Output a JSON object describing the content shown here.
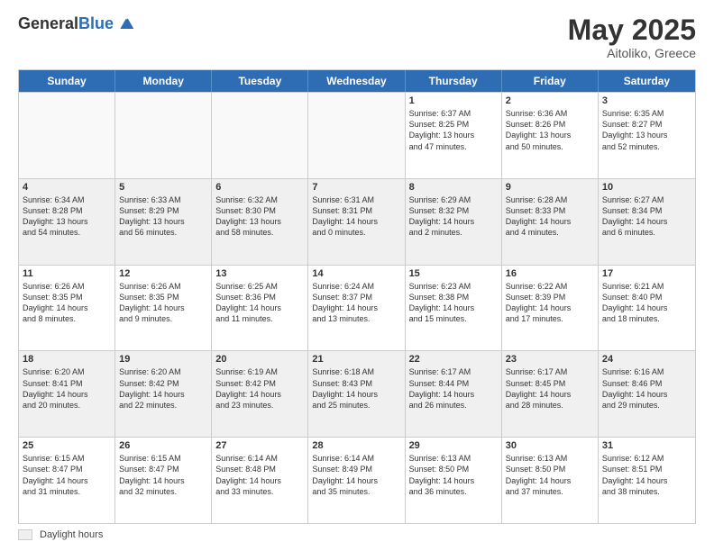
{
  "logo": {
    "general": "General",
    "blue": "Blue"
  },
  "title": "May 2025",
  "location": "Aitoliko, Greece",
  "days_of_week": [
    "Sunday",
    "Monday",
    "Tuesday",
    "Wednesday",
    "Thursday",
    "Friday",
    "Saturday"
  ],
  "legend": {
    "box_label": "Daylight hours"
  },
  "weeks": [
    [
      {
        "day": "",
        "info": "",
        "empty": true
      },
      {
        "day": "",
        "info": "",
        "empty": true
      },
      {
        "day": "",
        "info": "",
        "empty": true
      },
      {
        "day": "",
        "info": "",
        "empty": true
      },
      {
        "day": "1",
        "info": "Sunrise: 6:37 AM\nSunset: 8:25 PM\nDaylight: 13 hours\nand 47 minutes.",
        "empty": false
      },
      {
        "day": "2",
        "info": "Sunrise: 6:36 AM\nSunset: 8:26 PM\nDaylight: 13 hours\nand 50 minutes.",
        "empty": false
      },
      {
        "day": "3",
        "info": "Sunrise: 6:35 AM\nSunset: 8:27 PM\nDaylight: 13 hours\nand 52 minutes.",
        "empty": false
      }
    ],
    [
      {
        "day": "4",
        "info": "Sunrise: 6:34 AM\nSunset: 8:28 PM\nDaylight: 13 hours\nand 54 minutes.",
        "empty": false
      },
      {
        "day": "5",
        "info": "Sunrise: 6:33 AM\nSunset: 8:29 PM\nDaylight: 13 hours\nand 56 minutes.",
        "empty": false
      },
      {
        "day": "6",
        "info": "Sunrise: 6:32 AM\nSunset: 8:30 PM\nDaylight: 13 hours\nand 58 minutes.",
        "empty": false
      },
      {
        "day": "7",
        "info": "Sunrise: 6:31 AM\nSunset: 8:31 PM\nDaylight: 14 hours\nand 0 minutes.",
        "empty": false
      },
      {
        "day": "8",
        "info": "Sunrise: 6:29 AM\nSunset: 8:32 PM\nDaylight: 14 hours\nand 2 minutes.",
        "empty": false
      },
      {
        "day": "9",
        "info": "Sunrise: 6:28 AM\nSunset: 8:33 PM\nDaylight: 14 hours\nand 4 minutes.",
        "empty": false
      },
      {
        "day": "10",
        "info": "Sunrise: 6:27 AM\nSunset: 8:34 PM\nDaylight: 14 hours\nand 6 minutes.",
        "empty": false
      }
    ],
    [
      {
        "day": "11",
        "info": "Sunrise: 6:26 AM\nSunset: 8:35 PM\nDaylight: 14 hours\nand 8 minutes.",
        "empty": false
      },
      {
        "day": "12",
        "info": "Sunrise: 6:26 AM\nSunset: 8:35 PM\nDaylight: 14 hours\nand 9 minutes.",
        "empty": false
      },
      {
        "day": "13",
        "info": "Sunrise: 6:25 AM\nSunset: 8:36 PM\nDaylight: 14 hours\nand 11 minutes.",
        "empty": false
      },
      {
        "day": "14",
        "info": "Sunrise: 6:24 AM\nSunset: 8:37 PM\nDaylight: 14 hours\nand 13 minutes.",
        "empty": false
      },
      {
        "day": "15",
        "info": "Sunrise: 6:23 AM\nSunset: 8:38 PM\nDaylight: 14 hours\nand 15 minutes.",
        "empty": false
      },
      {
        "day": "16",
        "info": "Sunrise: 6:22 AM\nSunset: 8:39 PM\nDaylight: 14 hours\nand 17 minutes.",
        "empty": false
      },
      {
        "day": "17",
        "info": "Sunrise: 6:21 AM\nSunset: 8:40 PM\nDaylight: 14 hours\nand 18 minutes.",
        "empty": false
      }
    ],
    [
      {
        "day": "18",
        "info": "Sunrise: 6:20 AM\nSunset: 8:41 PM\nDaylight: 14 hours\nand 20 minutes.",
        "empty": false
      },
      {
        "day": "19",
        "info": "Sunrise: 6:20 AM\nSunset: 8:42 PM\nDaylight: 14 hours\nand 22 minutes.",
        "empty": false
      },
      {
        "day": "20",
        "info": "Sunrise: 6:19 AM\nSunset: 8:42 PM\nDaylight: 14 hours\nand 23 minutes.",
        "empty": false
      },
      {
        "day": "21",
        "info": "Sunrise: 6:18 AM\nSunset: 8:43 PM\nDaylight: 14 hours\nand 25 minutes.",
        "empty": false
      },
      {
        "day": "22",
        "info": "Sunrise: 6:17 AM\nSunset: 8:44 PM\nDaylight: 14 hours\nand 26 minutes.",
        "empty": false
      },
      {
        "day": "23",
        "info": "Sunrise: 6:17 AM\nSunset: 8:45 PM\nDaylight: 14 hours\nand 28 minutes.",
        "empty": false
      },
      {
        "day": "24",
        "info": "Sunrise: 6:16 AM\nSunset: 8:46 PM\nDaylight: 14 hours\nand 29 minutes.",
        "empty": false
      }
    ],
    [
      {
        "day": "25",
        "info": "Sunrise: 6:15 AM\nSunset: 8:47 PM\nDaylight: 14 hours\nand 31 minutes.",
        "empty": false
      },
      {
        "day": "26",
        "info": "Sunrise: 6:15 AM\nSunset: 8:47 PM\nDaylight: 14 hours\nand 32 minutes.",
        "empty": false
      },
      {
        "day": "27",
        "info": "Sunrise: 6:14 AM\nSunset: 8:48 PM\nDaylight: 14 hours\nand 33 minutes.",
        "empty": false
      },
      {
        "day": "28",
        "info": "Sunrise: 6:14 AM\nSunset: 8:49 PM\nDaylight: 14 hours\nand 35 minutes.",
        "empty": false
      },
      {
        "day": "29",
        "info": "Sunrise: 6:13 AM\nSunset: 8:50 PM\nDaylight: 14 hours\nand 36 minutes.",
        "empty": false
      },
      {
        "day": "30",
        "info": "Sunrise: 6:13 AM\nSunset: 8:50 PM\nDaylight: 14 hours\nand 37 minutes.",
        "empty": false
      },
      {
        "day": "31",
        "info": "Sunrise: 6:12 AM\nSunset: 8:51 PM\nDaylight: 14 hours\nand 38 minutes.",
        "empty": false
      }
    ]
  ]
}
